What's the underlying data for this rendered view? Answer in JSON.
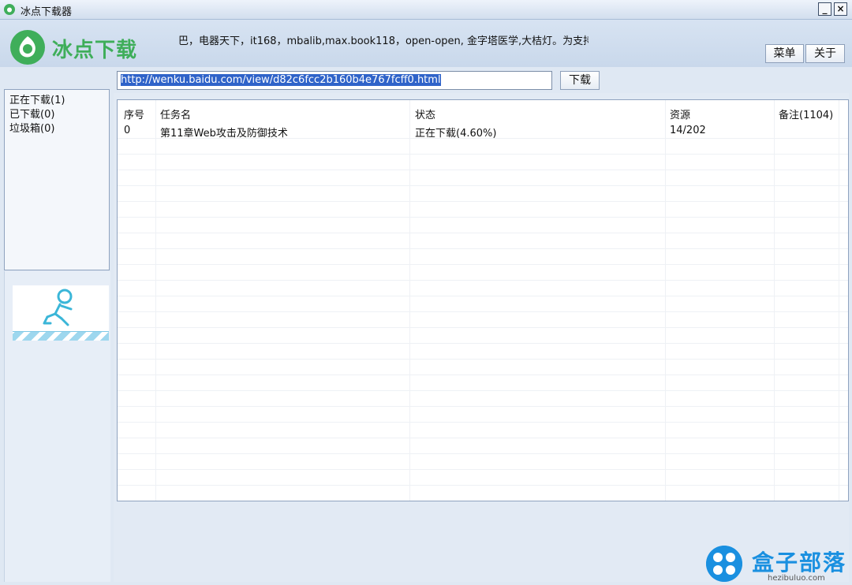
{
  "window": {
    "title": "冰点下载器",
    "minimize": "_",
    "close": "×"
  },
  "header": {
    "logo_text": "冰点下载",
    "marquee": "巴，电器天下，it168，mbalib,max.book118，open-open, 金字塔医学,大桔灯。为支持",
    "menu_button": "菜单",
    "about_button": "关于"
  },
  "url_bar": {
    "value": "http://wenku.baidu.com/view/d82c6fcc2b160b4e767fcff0.html",
    "download_button": "下载"
  },
  "sidebar": {
    "items": [
      {
        "label": "正在下载(1)"
      },
      {
        "label": "已下载(0)"
      },
      {
        "label": "垃圾箱(0)"
      }
    ]
  },
  "table": {
    "columns": {
      "index": "序号",
      "name": "任务名",
      "status": "状态",
      "resource": "资源",
      "note": "备注(1104)"
    },
    "rows": [
      {
        "index": "0",
        "name": "第11章Web攻击及防御技术",
        "status": "正在下载(4.60%)",
        "resource": "14/202",
        "note": ""
      }
    ]
  },
  "watermark": {
    "brand": "盒子部落",
    "url": "hezibuluo.com"
  },
  "colors": {
    "logo_green": "#3fae5a",
    "selection_blue": "#2f63c9",
    "watermark_blue": "#1a90e0"
  }
}
